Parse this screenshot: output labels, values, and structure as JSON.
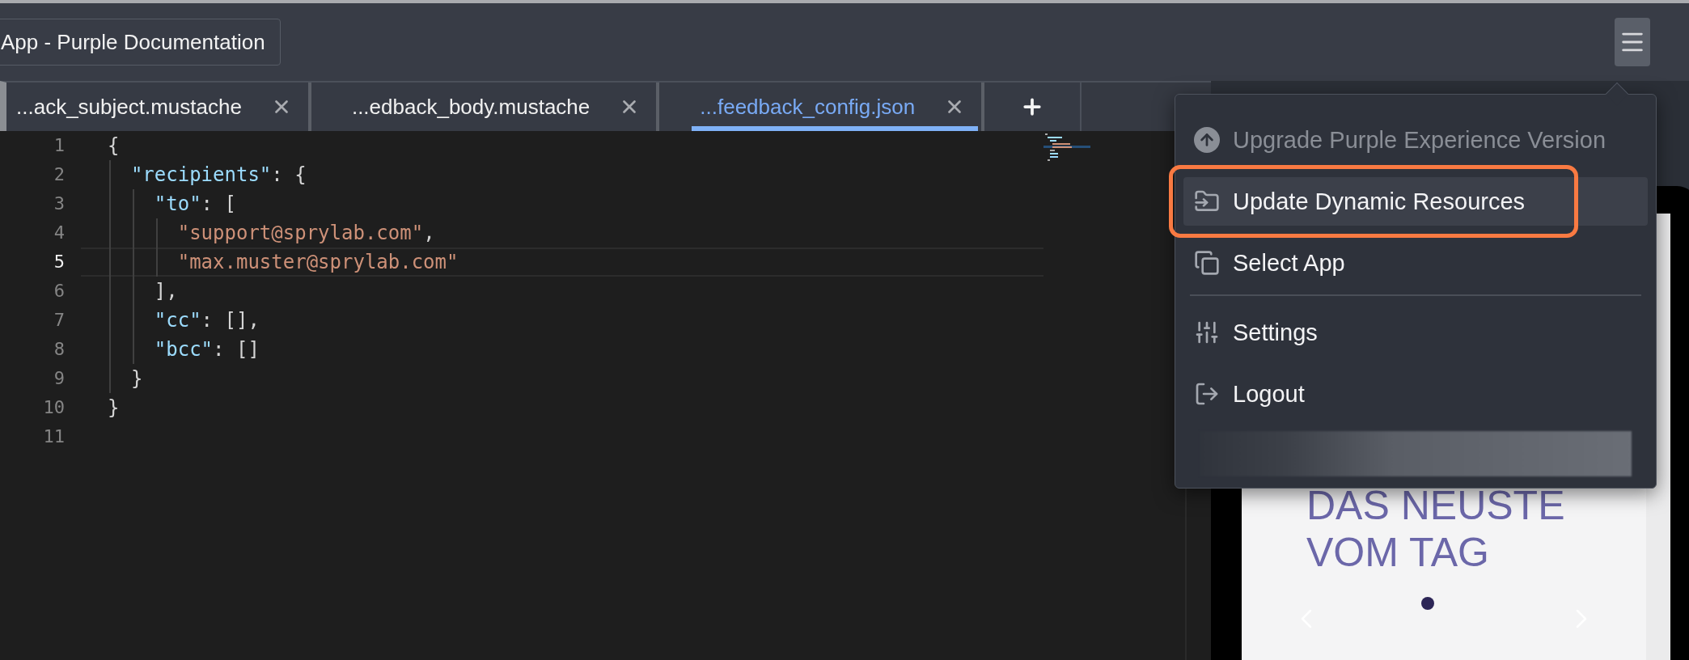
{
  "header": {
    "title": "App - Purple Documentation",
    "menu_open": true
  },
  "tabs": [
    {
      "label": "...ack_subject.mustache",
      "selected": false
    },
    {
      "label": "...edback_body.mustache",
      "selected": false
    },
    {
      "label": "...feedback_config.json",
      "selected": true
    }
  ],
  "editor": {
    "lines": [
      {
        "number": "1",
        "selected": false,
        "tokens": [
          {
            "kind": "punct",
            "text": "{"
          }
        ]
      },
      {
        "number": "2",
        "selected": false,
        "tokens": [
          {
            "kind": "key",
            "text": "  \"recipients\""
          },
          {
            "kind": "punct",
            "text": ": {"
          }
        ]
      },
      {
        "number": "3",
        "selected": false,
        "tokens": [
          {
            "kind": "key",
            "text": "    \"to\""
          },
          {
            "kind": "punct",
            "text": ": ["
          }
        ]
      },
      {
        "number": "4",
        "selected": false,
        "tokens": [
          {
            "kind": "string",
            "text": "      \"support@sprylab.com\""
          },
          {
            "kind": "punct",
            "text": ","
          }
        ]
      },
      {
        "number": "5",
        "selected": true,
        "tokens": [
          {
            "kind": "string",
            "text": "      \"max.muster@sprylab.com\""
          }
        ]
      },
      {
        "number": "6",
        "selected": false,
        "tokens": [
          {
            "kind": "punct",
            "text": "    ],"
          }
        ]
      },
      {
        "number": "7",
        "selected": false,
        "tokens": [
          {
            "kind": "key",
            "text": "    \"cc\""
          },
          {
            "kind": "punct",
            "text": ": [],"
          }
        ]
      },
      {
        "number": "8",
        "selected": false,
        "tokens": [
          {
            "kind": "key",
            "text": "    \"bcc\""
          },
          {
            "kind": "punct",
            "text": ": []"
          }
        ]
      },
      {
        "number": "9",
        "selected": false,
        "tokens": [
          {
            "kind": "punct",
            "text": "  }"
          }
        ]
      },
      {
        "number": "10",
        "selected": false,
        "tokens": [
          {
            "kind": "punct",
            "text": "}"
          }
        ]
      },
      {
        "number": "11",
        "selected": false
      }
    ]
  },
  "menu": {
    "items": [
      {
        "kind": "upgrade",
        "label": "Upgrade Purple Experience Version",
        "disabled": true,
        "selected": false,
        "annotated": false
      },
      {
        "kind": "resources",
        "label": "Update Dynamic Resources",
        "disabled": false,
        "selected": true,
        "annotated": true
      },
      {
        "kind": "apps",
        "label": "Select App",
        "disabled": false,
        "selected": false,
        "annotated": false
      },
      {
        "kind": "divider"
      },
      {
        "kind": "settings",
        "label": "Settings",
        "disabled": false,
        "selected": false,
        "annotated": false
      },
      {
        "kind": "logout",
        "label": "Logout",
        "disabled": false,
        "selected": false,
        "annotated": false
      },
      {
        "kind": "redacted"
      }
    ]
  },
  "preview": {
    "heading": "DAS NEUSTE VOM TAG",
    "pages": [
      {
        "selected": true
      }
    ]
  }
}
